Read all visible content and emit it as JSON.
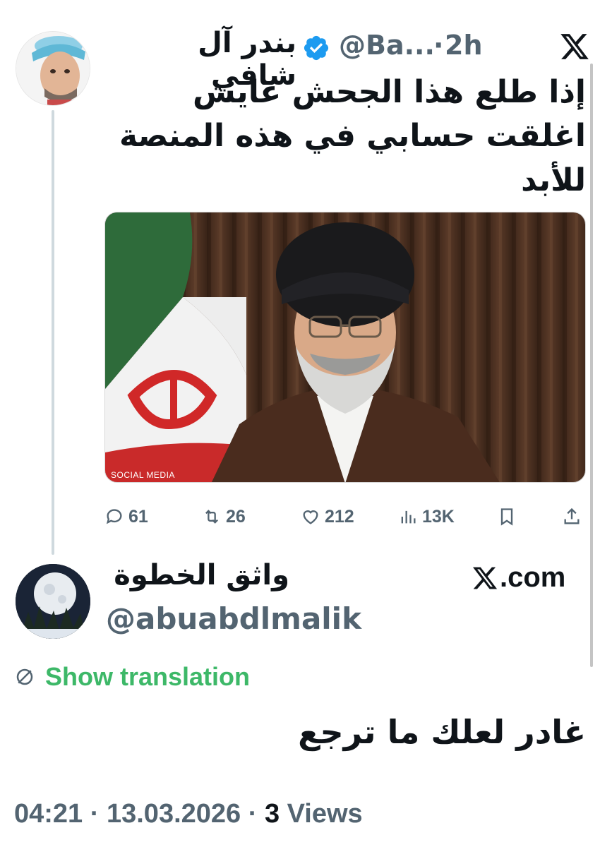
{
  "tweet": {
    "author_name": "بندر آل شافي",
    "handle": "@Ba...",
    "separator": "·",
    "time": "2h",
    "text": "إذا طلع هذا الجحش عايش اغلقت حسابي في هذه المنصة للأبد",
    "media_caption": "SOCIAL MEDIA",
    "stats": {
      "replies": "61",
      "reposts": "26",
      "likes": "212",
      "views": "13K"
    }
  },
  "quote": {
    "author_name": "واثق الخطوة",
    "handle": "@abuabdlmalik",
    "source_label": ".com",
    "translate_label": "Show translation",
    "text": "غادر لعلك ما ترجع"
  },
  "footer": {
    "time": "04:21",
    "sep1": " · ",
    "date": "13.03.2026",
    "sep2": " · ",
    "views_count": "3",
    "views_label": " Views"
  },
  "colors": {
    "text": "#0f1419",
    "secondary": "#536471",
    "verified": "#1d9bf0",
    "translate": "#3db868",
    "thread_line": "#cfd9de"
  },
  "icons": [
    "x-logo-icon",
    "verified-badge-icon",
    "reply-icon",
    "repost-icon",
    "like-icon",
    "views-icon",
    "bookmark-icon",
    "share-icon",
    "translate-globe-icon"
  ]
}
